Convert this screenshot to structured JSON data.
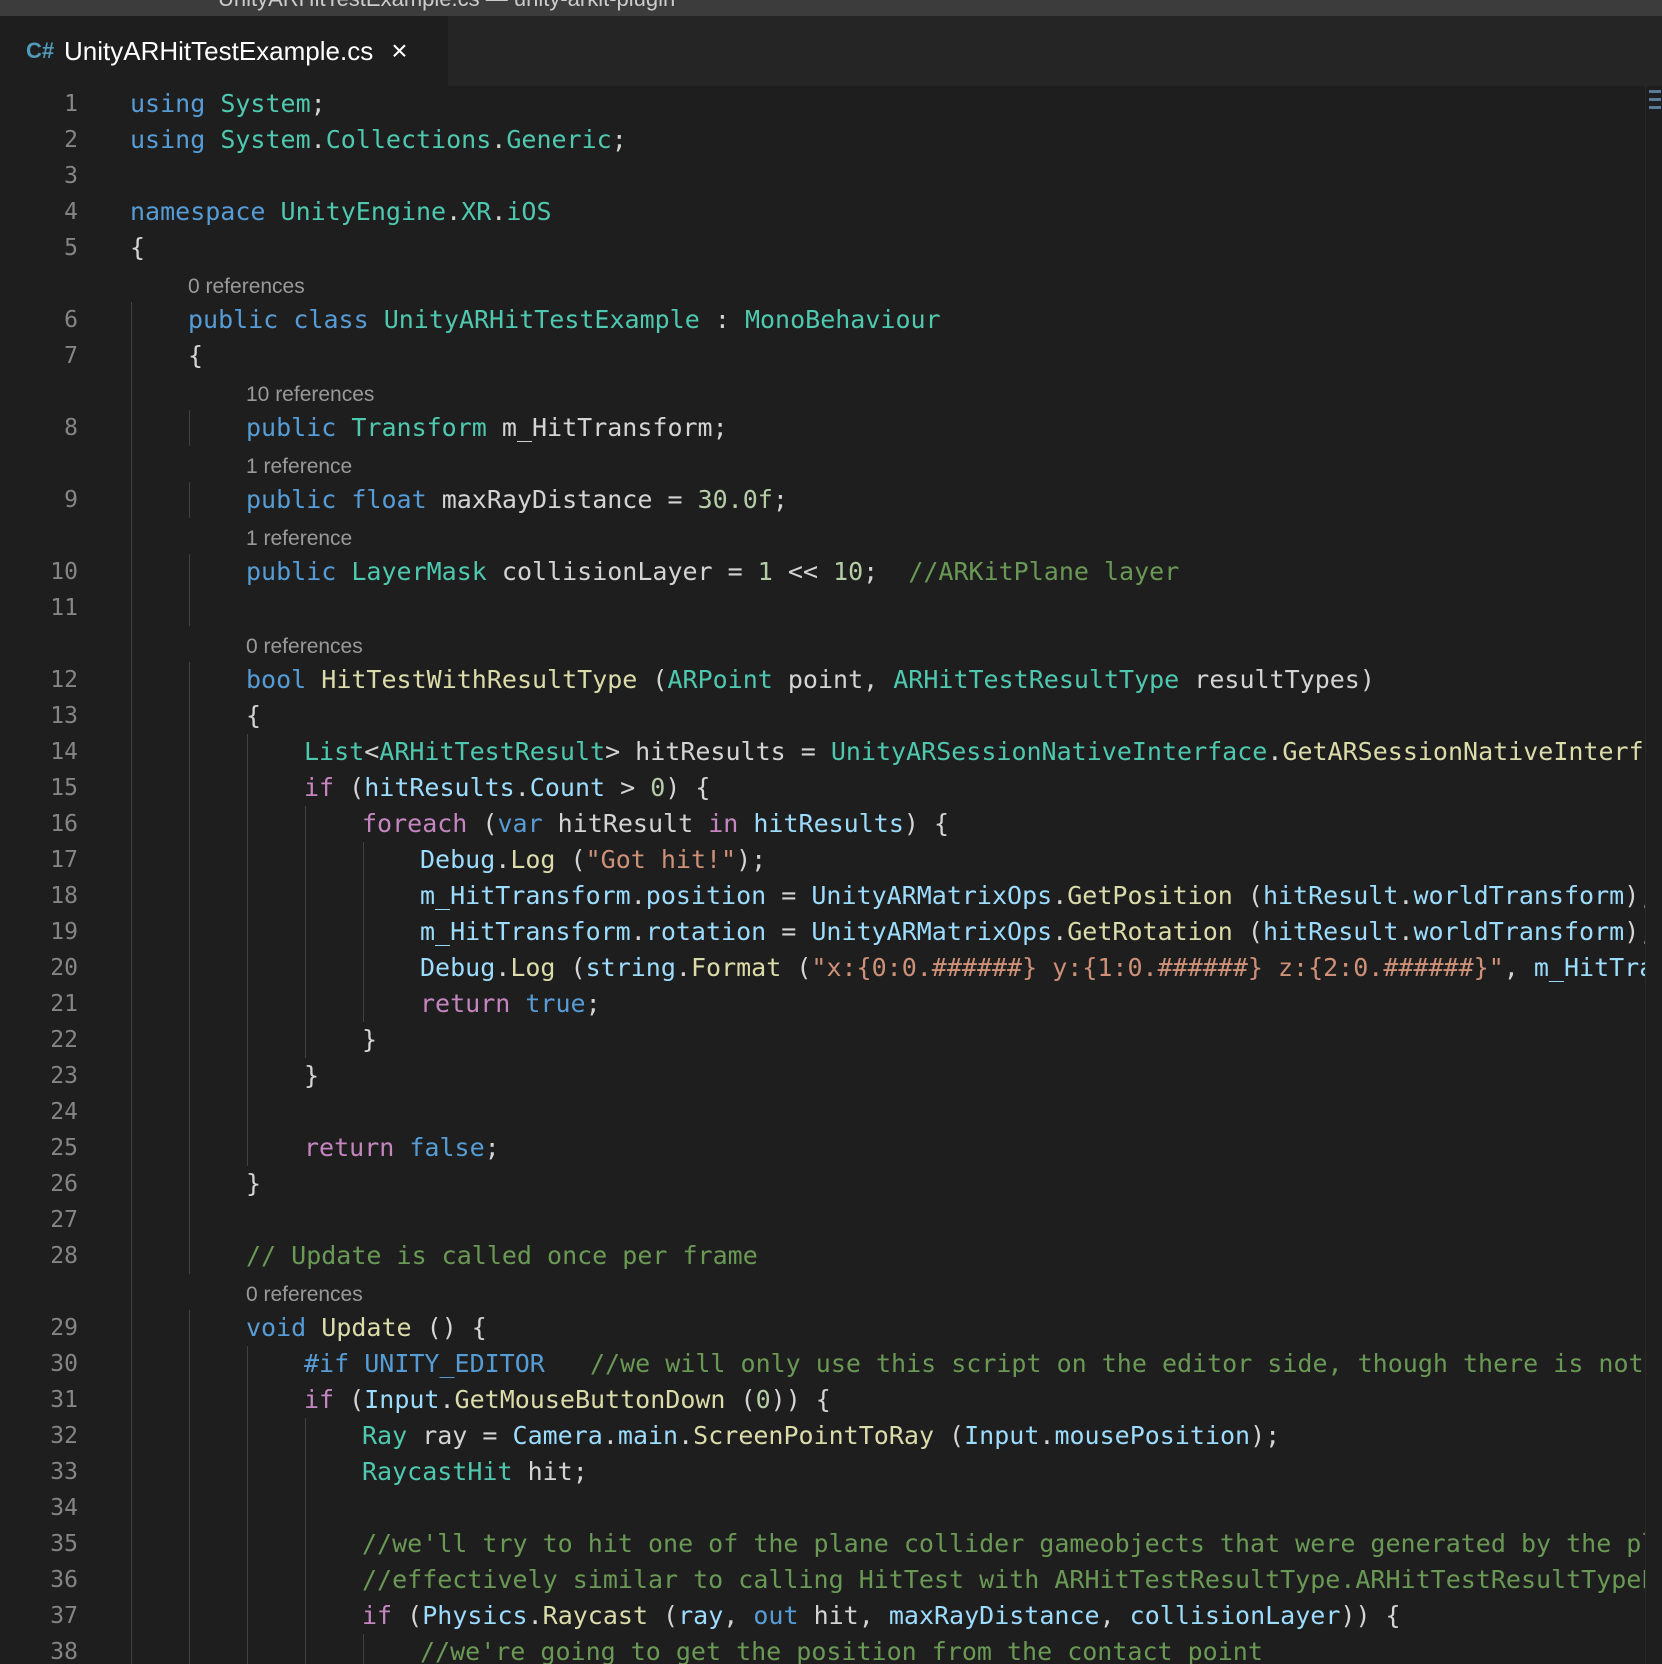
{
  "window": {
    "title": "UnityARHitTestExample.cs — unity-arkit-plugin"
  },
  "tab": {
    "file_icon": "C#",
    "label": "UnityARHitTestExample.cs",
    "close_glyph": "×"
  },
  "colors": {
    "keyword": "#569cd6",
    "control": "#c586c0",
    "type": "#4ec9b0",
    "function": "#dcdcaa",
    "variable": "#9cdcfe",
    "string": "#ce9178",
    "number": "#b5cea8",
    "comment": "#6a9955",
    "plain": "#d4d4d4",
    "line_number": "#858585",
    "codelens": "#999999",
    "background": "#1e1e1e"
  },
  "lines": [
    {
      "n": "1",
      "indent": 0,
      "tokens": [
        [
          "k",
          "using"
        ],
        [
          "p",
          " "
        ],
        [
          "t",
          "System"
        ],
        [
          "p",
          ";"
        ]
      ]
    },
    {
      "n": "2",
      "indent": 0,
      "tokens": [
        [
          "k",
          "using"
        ],
        [
          "p",
          " "
        ],
        [
          "t",
          "System"
        ],
        [
          "p",
          "."
        ],
        [
          "t",
          "Collections"
        ],
        [
          "p",
          "."
        ],
        [
          "t",
          "Generic"
        ],
        [
          "p",
          ";"
        ]
      ]
    },
    {
      "n": "3",
      "indent": 0,
      "tokens": []
    },
    {
      "n": "4",
      "indent": 0,
      "tokens": [
        [
          "k",
          "namespace"
        ],
        [
          "p",
          " "
        ],
        [
          "t",
          "UnityEngine"
        ],
        [
          "p",
          "."
        ],
        [
          "t",
          "XR"
        ],
        [
          "p",
          "."
        ],
        [
          "t",
          "iOS"
        ]
      ]
    },
    {
      "n": "5",
      "indent": 0,
      "tokens": [
        [
          "p",
          "{"
        ]
      ]
    },
    {
      "ref": "0 references",
      "indent": 1
    },
    {
      "n": "6",
      "indent": 1,
      "tokens": [
        [
          "k",
          "public"
        ],
        [
          "p",
          " "
        ],
        [
          "k",
          "class"
        ],
        [
          "p",
          " "
        ],
        [
          "t",
          "UnityARHitTestExample"
        ],
        [
          "p",
          " : "
        ],
        [
          "t",
          "MonoBehaviour"
        ]
      ]
    },
    {
      "n": "7",
      "indent": 1,
      "tokens": [
        [
          "p",
          "{"
        ]
      ]
    },
    {
      "ref": "10 references",
      "indent": 2
    },
    {
      "n": "8",
      "indent": 2,
      "tokens": [
        [
          "k",
          "public"
        ],
        [
          "p",
          " "
        ],
        [
          "t",
          "Transform"
        ],
        [
          "p",
          " m_HitTransform;"
        ]
      ]
    },
    {
      "ref": "1 reference",
      "indent": 2
    },
    {
      "n": "9",
      "indent": 2,
      "tokens": [
        [
          "k",
          "public"
        ],
        [
          "p",
          " "
        ],
        [
          "k",
          "float"
        ],
        [
          "p",
          " maxRayDistance = "
        ],
        [
          "n",
          "30.0f"
        ],
        [
          "p",
          ";"
        ]
      ]
    },
    {
      "ref": "1 reference",
      "indent": 2
    },
    {
      "n": "10",
      "indent": 2,
      "tokens": [
        [
          "k",
          "public"
        ],
        [
          "p",
          " "
        ],
        [
          "t",
          "LayerMask"
        ],
        [
          "p",
          " collisionLayer = "
        ],
        [
          "n",
          "1"
        ],
        [
          "p",
          " << "
        ],
        [
          "n",
          "10"
        ],
        [
          "p",
          ";  "
        ],
        [
          "m",
          "//ARKitPlane layer"
        ]
      ]
    },
    {
      "n": "11",
      "indent": 2,
      "tokens": []
    },
    {
      "ref": "0 references",
      "indent": 2
    },
    {
      "n": "12",
      "indent": 2,
      "tokens": [
        [
          "k",
          "bool"
        ],
        [
          "p",
          " "
        ],
        [
          "f",
          "HitTestWithResultType"
        ],
        [
          "p",
          " ("
        ],
        [
          "t",
          "ARPoint"
        ],
        [
          "p",
          " point, "
        ],
        [
          "t",
          "ARHitTestResultType"
        ],
        [
          "p",
          " resultTypes)"
        ]
      ]
    },
    {
      "n": "13",
      "indent": 2,
      "tokens": [
        [
          "p",
          "{"
        ]
      ]
    },
    {
      "n": "14",
      "indent": 3,
      "tokens": [
        [
          "t",
          "List"
        ],
        [
          "p",
          "<"
        ],
        [
          "t",
          "ARHitTestResult"
        ],
        [
          "p",
          "> hitResults = "
        ],
        [
          "t",
          "UnityARSessionNativeInterface"
        ],
        [
          "p",
          "."
        ],
        [
          "f",
          "GetARSessionNativeInterface"
        ]
      ]
    },
    {
      "n": "15",
      "indent": 3,
      "tokens": [
        [
          "c",
          "if"
        ],
        [
          "p",
          " ("
        ],
        [
          "v",
          "hitResults"
        ],
        [
          "p",
          "."
        ],
        [
          "v",
          "Count"
        ],
        [
          "p",
          " > "
        ],
        [
          "n",
          "0"
        ],
        [
          "p",
          ") {"
        ]
      ]
    },
    {
      "n": "16",
      "indent": 4,
      "tokens": [
        [
          "c",
          "foreach"
        ],
        [
          "p",
          " ("
        ],
        [
          "k",
          "var"
        ],
        [
          "p",
          " hitResult "
        ],
        [
          "c",
          "in"
        ],
        [
          "p",
          " "
        ],
        [
          "v",
          "hitResults"
        ],
        [
          "p",
          ") {"
        ]
      ]
    },
    {
      "n": "17",
      "indent": 5,
      "tokens": [
        [
          "v",
          "Debug"
        ],
        [
          "p",
          "."
        ],
        [
          "f",
          "Log"
        ],
        [
          "p",
          " ("
        ],
        [
          "s",
          "\"Got hit!\""
        ],
        [
          "p",
          ");"
        ]
      ]
    },
    {
      "n": "18",
      "indent": 5,
      "tokens": [
        [
          "v",
          "m_HitTransform"
        ],
        [
          "p",
          "."
        ],
        [
          "v",
          "position"
        ],
        [
          "p",
          " = "
        ],
        [
          "v",
          "UnityARMatrixOps"
        ],
        [
          "p",
          "."
        ],
        [
          "f",
          "GetPosition"
        ],
        [
          "p",
          " ("
        ],
        [
          "v",
          "hitResult"
        ],
        [
          "p",
          "."
        ],
        [
          "v",
          "worldTransform"
        ],
        [
          "p",
          ");"
        ]
      ]
    },
    {
      "n": "19",
      "indent": 5,
      "tokens": [
        [
          "v",
          "m_HitTransform"
        ],
        [
          "p",
          "."
        ],
        [
          "v",
          "rotation"
        ],
        [
          "p",
          " = "
        ],
        [
          "v",
          "UnityARMatrixOps"
        ],
        [
          "p",
          "."
        ],
        [
          "f",
          "GetRotation"
        ],
        [
          "p",
          " ("
        ],
        [
          "v",
          "hitResult"
        ],
        [
          "p",
          "."
        ],
        [
          "v",
          "worldTransform"
        ],
        [
          "p",
          ");"
        ]
      ]
    },
    {
      "n": "20",
      "indent": 5,
      "tokens": [
        [
          "v",
          "Debug"
        ],
        [
          "p",
          "."
        ],
        [
          "f",
          "Log"
        ],
        [
          "p",
          " ("
        ],
        [
          "v",
          "string"
        ],
        [
          "p",
          "."
        ],
        [
          "f",
          "Format"
        ],
        [
          "p",
          " ("
        ],
        [
          "s",
          "\"x:{0:0.######} y:{1:0.######} z:{2:0.######}\""
        ],
        [
          "p",
          ", "
        ],
        [
          "v",
          "m_HitTransf"
        ]
      ]
    },
    {
      "n": "21",
      "indent": 5,
      "tokens": [
        [
          "c",
          "return"
        ],
        [
          "p",
          " "
        ],
        [
          "k",
          "true"
        ],
        [
          "p",
          ";"
        ]
      ]
    },
    {
      "n": "22",
      "indent": 4,
      "tokens": [
        [
          "p",
          "}"
        ]
      ]
    },
    {
      "n": "23",
      "indent": 3,
      "tokens": [
        [
          "p",
          "}"
        ]
      ]
    },
    {
      "n": "24",
      "indent": 3,
      "tokens": []
    },
    {
      "n": "25",
      "indent": 3,
      "tokens": [
        [
          "c",
          "return"
        ],
        [
          "p",
          " "
        ],
        [
          "k",
          "false"
        ],
        [
          "p",
          ";"
        ]
      ]
    },
    {
      "n": "26",
      "indent": 2,
      "tokens": [
        [
          "p",
          "}"
        ]
      ]
    },
    {
      "n": "27",
      "indent": 2,
      "tokens": []
    },
    {
      "n": "28",
      "indent": 2,
      "tokens": [
        [
          "m",
          "// Update is called once per frame"
        ]
      ]
    },
    {
      "ref": "0 references",
      "indent": 2
    },
    {
      "n": "29",
      "indent": 2,
      "tokens": [
        [
          "k",
          "void"
        ],
        [
          "p",
          " "
        ],
        [
          "f",
          "Update"
        ],
        [
          "p",
          " () {"
        ]
      ]
    },
    {
      "n": "30",
      "indent": 3,
      "tokens": [
        [
          "k",
          "#if"
        ],
        [
          "p",
          " "
        ],
        [
          "k",
          "UNITY_EDITOR"
        ],
        [
          "p",
          "   "
        ],
        [
          "m",
          "//we will only use this script on the editor side, though there is nothing"
        ]
      ]
    },
    {
      "n": "31",
      "indent": 3,
      "tokens": [
        [
          "c",
          "if"
        ],
        [
          "p",
          " ("
        ],
        [
          "v",
          "Input"
        ],
        [
          "p",
          "."
        ],
        [
          "f",
          "GetMouseButtonDown"
        ],
        [
          "p",
          " ("
        ],
        [
          "n",
          "0"
        ],
        [
          "p",
          ")) {"
        ]
      ]
    },
    {
      "n": "32",
      "indent": 4,
      "tokens": [
        [
          "t",
          "Ray"
        ],
        [
          "p",
          " ray = "
        ],
        [
          "v",
          "Camera"
        ],
        [
          "p",
          "."
        ],
        [
          "v",
          "main"
        ],
        [
          "p",
          "."
        ],
        [
          "f",
          "ScreenPointToRay"
        ],
        [
          "p",
          " ("
        ],
        [
          "v",
          "Input"
        ],
        [
          "p",
          "."
        ],
        [
          "v",
          "mousePosition"
        ],
        [
          "p",
          ");"
        ]
      ]
    },
    {
      "n": "33",
      "indent": 4,
      "tokens": [
        [
          "t",
          "RaycastHit"
        ],
        [
          "p",
          " hit;"
        ]
      ]
    },
    {
      "n": "34",
      "indent": 4,
      "tokens": []
    },
    {
      "n": "35",
      "indent": 4,
      "tokens": [
        [
          "m",
          "//we'll try to hit one of the plane collider gameobjects that were generated by the plugi"
        ]
      ]
    },
    {
      "n": "36",
      "indent": 4,
      "tokens": [
        [
          "m",
          "//effectively similar to calling HitTest with ARHitTestResultType.ARHitTestResultTypeExis"
        ]
      ]
    },
    {
      "n": "37",
      "indent": 4,
      "tokens": [
        [
          "c",
          "if"
        ],
        [
          "p",
          " ("
        ],
        [
          "v",
          "Physics"
        ],
        [
          "p",
          "."
        ],
        [
          "f",
          "Raycast"
        ],
        [
          "p",
          " ("
        ],
        [
          "v",
          "ray"
        ],
        [
          "p",
          ", "
        ],
        [
          "k",
          "out"
        ],
        [
          "p",
          " hit, "
        ],
        [
          "v",
          "maxRayDistance"
        ],
        [
          "p",
          ", "
        ],
        [
          "v",
          "collisionLayer"
        ],
        [
          "p",
          ")) {"
        ]
      ]
    },
    {
      "n": "38",
      "indent": 5,
      "tokens": [
        [
          "m",
          "//we're going to get the position from the contact point"
        ]
      ]
    }
  ]
}
